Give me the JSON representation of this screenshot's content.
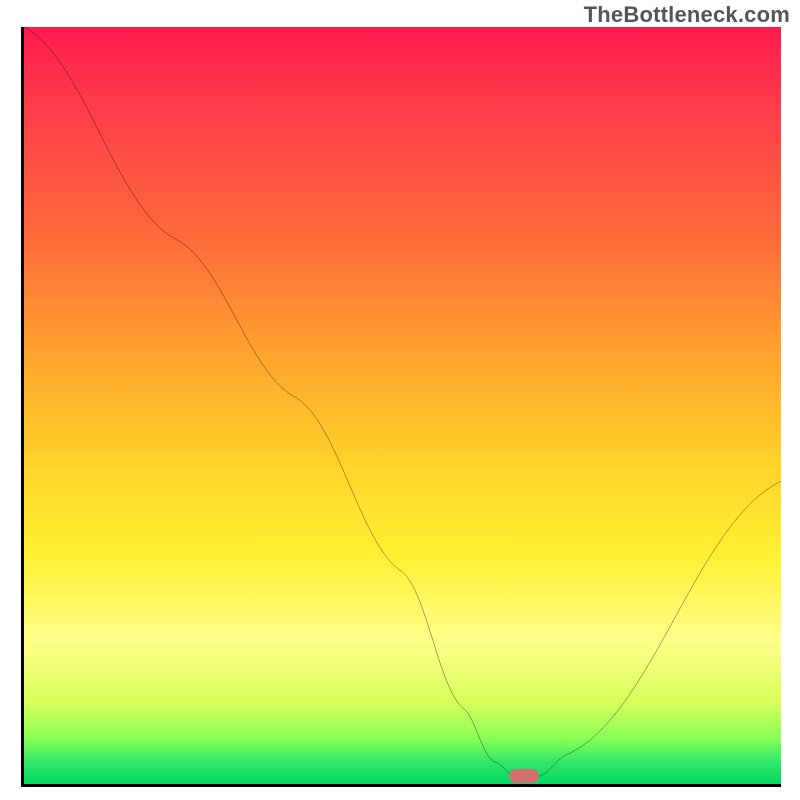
{
  "watermark": "TheBottleneck.com",
  "chart_data": {
    "type": "line",
    "title": "",
    "xlabel": "",
    "ylabel": "",
    "xlim": [
      0,
      100
    ],
    "ylim": [
      0,
      100
    ],
    "series": [
      {
        "name": "bottleneck-curve",
        "x": [
          0,
          20,
          36,
          50,
          58,
          62,
          65,
          68,
          72,
          100
        ],
        "values": [
          100,
          72,
          51,
          28,
          10,
          3,
          1,
          1,
          4,
          40
        ]
      }
    ],
    "marker": {
      "name": "optimal-point",
      "x": 66,
      "y": 1,
      "shape": "pill",
      "color": "#d36f6f"
    },
    "gradient_stops": [
      {
        "pos": 0,
        "color": "#ff1a4d"
      },
      {
        "pos": 10,
        "color": "#ff3b4b"
      },
      {
        "pos": 28,
        "color": "#ff6a3a"
      },
      {
        "pos": 44,
        "color": "#ffa62e"
      },
      {
        "pos": 58,
        "color": "#ffd429"
      },
      {
        "pos": 70,
        "color": "#fff133"
      },
      {
        "pos": 81,
        "color": "#ffff8a"
      },
      {
        "pos": 89,
        "color": "#d9ff5a"
      },
      {
        "pos": 94,
        "color": "#8aff55"
      },
      {
        "pos": 97,
        "color": "#34e86a"
      },
      {
        "pos": 100,
        "color": "#00d861"
      }
    ]
  }
}
